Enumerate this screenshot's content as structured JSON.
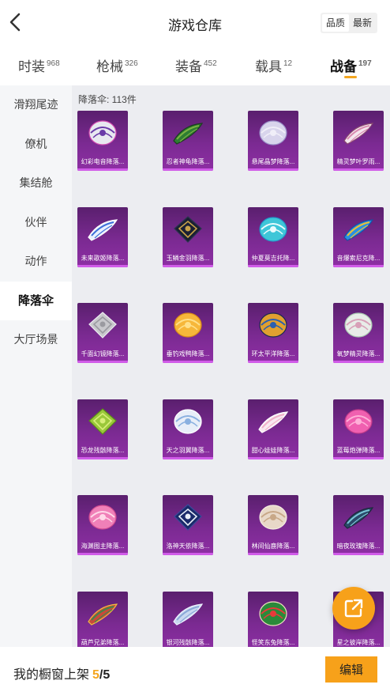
{
  "header": {
    "title": "游戏仓库",
    "sort_options": [
      "品质",
      "最新"
    ],
    "sort_active": 0
  },
  "tabs": [
    {
      "label": "时装",
      "count": "968"
    },
    {
      "label": "枪械",
      "count": "326"
    },
    {
      "label": "装备",
      "count": "452"
    },
    {
      "label": "载具",
      "count": "12"
    },
    {
      "label": "战备",
      "count": "197"
    }
  ],
  "sidebar": [
    "滑翔尾迹",
    "僚机",
    "集结舱",
    "伙伴",
    "动作",
    "降落伞",
    "大厅场景"
  ],
  "content": {
    "count_label": "降落伞: 113件",
    "items": [
      {
        "name": "幻彩电音降落...",
        "shape": "round",
        "colors": [
          "#e8e8f0",
          "#6a3aa8",
          "#d14ab0"
        ]
      },
      {
        "name": "忍者神龟降落...",
        "shape": "wing",
        "colors": [
          "#2e7d32",
          "#7cb342",
          "#1b3d1f"
        ]
      },
      {
        "name": "悬尾晶梦降落...",
        "shape": "round",
        "colors": [
          "#d8d4ec",
          "#f0eef8",
          "#9a8fc8"
        ]
      },
      {
        "name": "精灵梦叶罗雨...",
        "shape": "wing",
        "colors": [
          "#f4e6ee",
          "#d98bb0",
          "#8a4a70"
        ]
      },
      {
        "name": "未来歌姬降落...",
        "shape": "wing",
        "colors": [
          "#e8f0ff",
          "#3b6fd8",
          "#ffffff"
        ]
      },
      {
        "name": "玉鳞金羽降落...",
        "shape": "diamond",
        "colors": [
          "#1a2033",
          "#c8a24a",
          "#2c3550"
        ]
      },
      {
        "name": "仲夏莫吉托降...",
        "shape": "round",
        "colors": [
          "#3ec6d8",
          "#e8fbfd",
          "#2196c8"
        ]
      },
      {
        "name": "音爆索尼克降...",
        "shape": "wing",
        "colors": [
          "#2a8fe0",
          "#f0c030",
          "#1a4fa0"
        ]
      },
      {
        "name": "千面幻镜降落...",
        "shape": "diamond",
        "colors": [
          "#c8c8cc",
          "#9a9aa0",
          "#ececf0"
        ]
      },
      {
        "name": "垂钓戏鸭降落...",
        "shape": "round",
        "colors": [
          "#f6b73a",
          "#ffe08a",
          "#d88a1a"
        ]
      },
      {
        "name": "环太平洋降落...",
        "shape": "round",
        "colors": [
          "#e0a030",
          "#2a5fb0",
          "#1a2a50"
        ]
      },
      {
        "name": "氧梦精灵降落...",
        "shape": "round",
        "colors": [
          "#e8ece8",
          "#d8a0b8",
          "#a8c8b0"
        ]
      },
      {
        "name": "恐龙残骸降落...",
        "shape": "diamond",
        "colors": [
          "#9ac83a",
          "#d8ee7a",
          "#5a8a1a"
        ]
      },
      {
        "name": "天之羽翼降落...",
        "shape": "round",
        "colors": [
          "#e8eef8",
          "#8ab0e0",
          "#ffffff"
        ]
      },
      {
        "name": "甜心娃娃降落...",
        "shape": "wing",
        "colors": [
          "#f8e8f0",
          "#f0b0c8",
          "#ffffff"
        ]
      },
      {
        "name": "蓝莓炮弹降落...",
        "shape": "round",
        "colors": [
          "#f060b0",
          "#ffb0d8",
          "#c03a88"
        ]
      },
      {
        "name": "海渊图主降落...",
        "shape": "round",
        "colors": [
          "#f080b8",
          "#ffd8e8",
          "#d04a90"
        ]
      },
      {
        "name": "洛神天依降落...",
        "shape": "diamond",
        "colors": [
          "#1a2a6a",
          "#e8eef8",
          "#3a4a9a"
        ]
      },
      {
        "name": "林间仙鹿降落...",
        "shape": "round",
        "colors": [
          "#e8d8c8",
          "#c8a888",
          "#f4ece0"
        ]
      },
      {
        "name": "暗夜玫瑰降落...",
        "shape": "wing",
        "colors": [
          "#2a4a6a",
          "#7ac8d8",
          "#1a2a3a"
        ]
      },
      {
        "name": "葫芦兄弟降落...",
        "shape": "wing",
        "colors": [
          "#c84a3a",
          "#3a8a4a",
          "#f0c040"
        ]
      },
      {
        "name": "银河残骸降落...",
        "shape": "wing",
        "colors": [
          "#c8d8f0",
          "#8aa8d8",
          "#eef4ff"
        ]
      },
      {
        "name": "怪笑东兔降落...",
        "shape": "round",
        "colors": [
          "#2a8a3a",
          "#e83a3a",
          "#f0e0c0"
        ]
      },
      {
        "name": "星之彼岸降落...",
        "shape": "wing",
        "colors": [
          "#3a3a8a",
          "#e8c8f0",
          "#6a3ab0"
        ]
      }
    ]
  },
  "fab": {
    "icon": "share-external-icon"
  },
  "footer": {
    "label": "我的橱窗上架",
    "current": "5",
    "total": "/5",
    "edit_label": "编辑"
  }
}
